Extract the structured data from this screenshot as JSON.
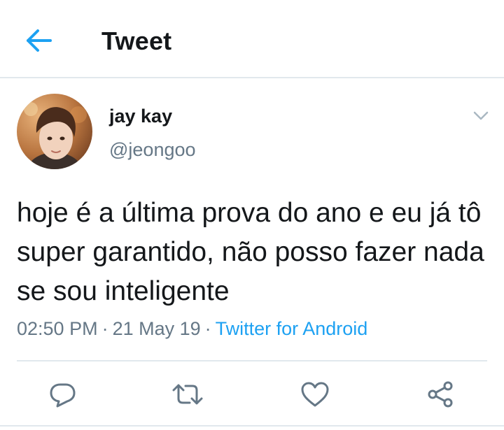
{
  "header": {
    "title": "Tweet",
    "back_icon": "arrow-left-icon"
  },
  "author": {
    "display_name": "jay kay",
    "handle": "@jeongoo"
  },
  "tweet": {
    "text": "hoje é a última prova do ano e eu já tô super garantido, não posso fazer nada se sou inteligente",
    "time": "02:50 PM",
    "date": "21 May 19",
    "source": "Twitter for Android",
    "separator": "·"
  },
  "actions": [
    "reply-icon",
    "retweet-icon",
    "like-icon",
    "share-icon"
  ],
  "colors": {
    "accent": "#1da1f2",
    "secondary_text": "#657786",
    "primary_text": "#14171a",
    "divider": "#e1e8ed"
  }
}
